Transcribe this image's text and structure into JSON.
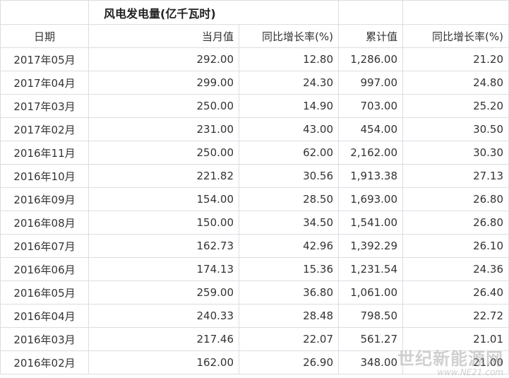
{
  "table": {
    "title": "风电发电量(亿千瓦时)",
    "headers": [
      "日期",
      "当月值",
      "同比增长率(%)",
      "累计值",
      "同比增长率(%)"
    ],
    "rows": [
      [
        "2017年05月",
        "292.00",
        "12.80",
        "1,286.00",
        "21.20"
      ],
      [
        "2017年04月",
        "299.00",
        "24.30",
        "997.00",
        "24.80"
      ],
      [
        "2017年03月",
        "250.00",
        "14.90",
        "703.00",
        "25.20"
      ],
      [
        "2017年02月",
        "231.00",
        "43.00",
        "454.00",
        "30.50"
      ],
      [
        "2016年11月",
        "250.00",
        "62.00",
        "2,162.00",
        "30.30"
      ],
      [
        "2016年10月",
        "221.82",
        "30.56",
        "1,913.38",
        "27.13"
      ],
      [
        "2016年09月",
        "154.00",
        "28.50",
        "1,693.00",
        "26.80"
      ],
      [
        "2016年08月",
        "150.00",
        "34.50",
        "1,541.00",
        "26.80"
      ],
      [
        "2016年07月",
        "162.73",
        "42.96",
        "1,392.29",
        "26.10"
      ],
      [
        "2016年06月",
        "174.13",
        "15.36",
        "1,231.54",
        "24.36"
      ],
      [
        "2016年05月",
        "259.00",
        "36.80",
        "1,061.00",
        "26.40"
      ],
      [
        "2016年04月",
        "240.33",
        "28.48",
        "798.50",
        "22.72"
      ],
      [
        "2016年03月",
        "217.46",
        "22.07",
        "561.27",
        "21.01"
      ],
      [
        "2016年02月",
        "162.00",
        "26.90",
        "348.00",
        "21.00"
      ]
    ]
  },
  "watermark": {
    "name": "世纪新能源网",
    "url": "www.NE21.com"
  }
}
